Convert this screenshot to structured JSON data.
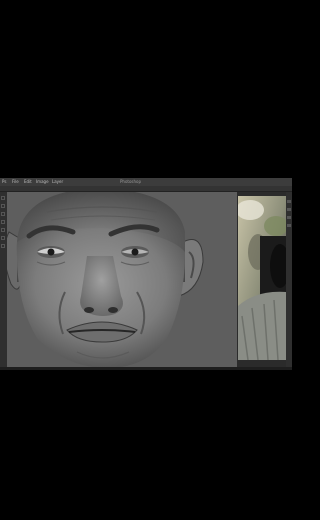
{
  "app": {
    "menu": [
      "Ps",
      "File",
      "Edit",
      "Image",
      "Layer"
    ],
    "window_title": "Photoshop"
  },
  "canvas": {
    "subject": "painted-face"
  },
  "reference": {
    "subject": "reference-photo"
  },
  "colors": {
    "background": "#000000",
    "chrome": "#2b2b2b",
    "canvas_bg": "#5e5e5e"
  }
}
